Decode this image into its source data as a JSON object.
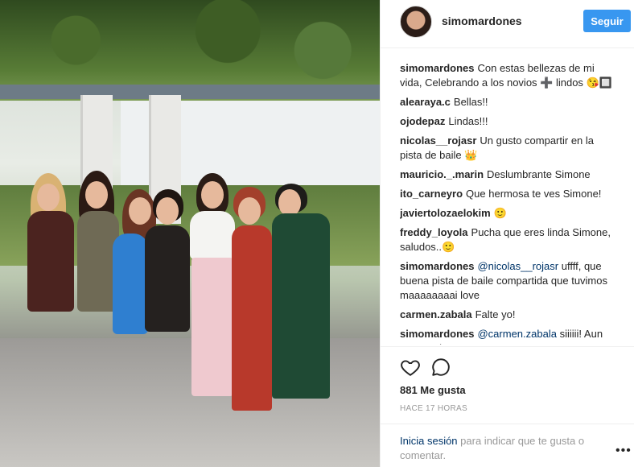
{
  "post": {
    "username": "simomardones",
    "follow_label": "Seguir",
    "caption": {
      "user": "simomardones",
      "text": "Con estas bellezas de mi vida, Celebrando a los novios ➕ lindos 😘🔲"
    },
    "comments": [
      {
        "user": "alearaya.c",
        "text": "Bellas!!"
      },
      {
        "user": "ojodepaz",
        "text": "Lindas!!!"
      },
      {
        "user": "nicolas__rojasr",
        "text": "Un gusto compartir en la pista de baile 👑"
      },
      {
        "user": "mauricio._.marin",
        "text": "Deslumbrante Simone"
      },
      {
        "user": "ito_carneyro",
        "text": "Que hermosa te ves Simone!"
      },
      {
        "user": "javiertolozaelokim",
        "text": "🙂"
      },
      {
        "user": "freddy_loyola",
        "text": "Pucha que eres linda Simone, saludos..🙂"
      },
      {
        "user": "simomardones",
        "mention": "@nicolas__rojasr",
        "text": "uffff, que buena pista de baile compartida que tuvimos maaaaaaaai love"
      },
      {
        "user": "carmen.zabala",
        "text": "Falte yo!"
      },
      {
        "user": "simomardones",
        "mention": "@carmen.zabala",
        "text": "siiiiii! Aun estas a tiempo"
      }
    ],
    "likes": "881 Me gusta",
    "timestamp": "HACE 17 HORAS",
    "footer": {
      "login": "Inicia sesión",
      "rest": "para indicar que te gusta o comentar."
    },
    "more_label": "•••"
  }
}
